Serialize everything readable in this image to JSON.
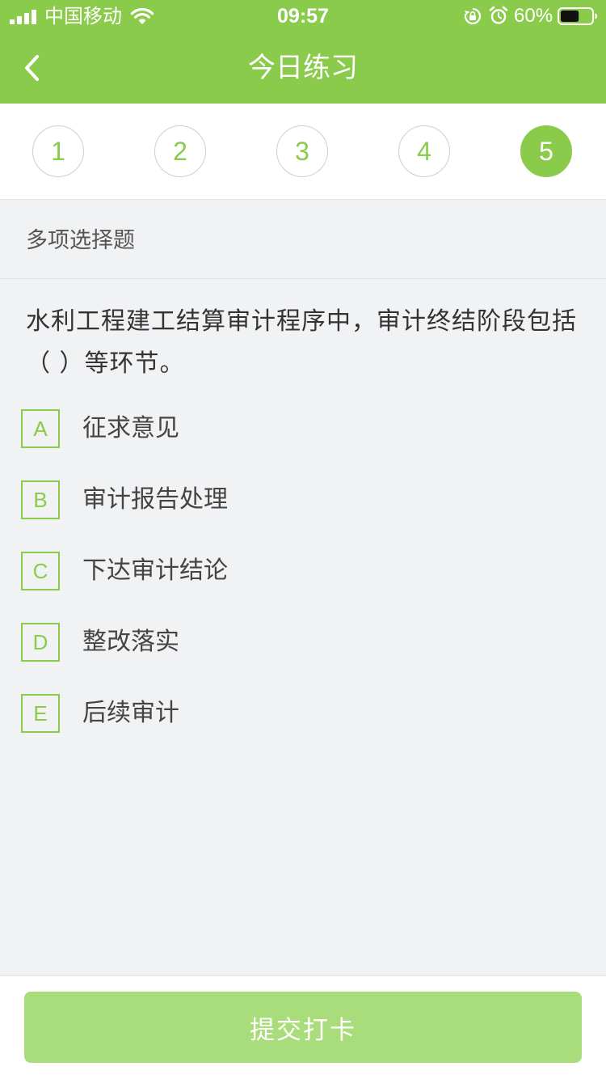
{
  "status_bar": {
    "carrier": "中国移动",
    "time": "09:57",
    "battery_percent": "60%",
    "battery_level": 0.6,
    "icons": [
      "signal-icon",
      "wifi-icon",
      "orientation-lock-icon",
      "alarm-icon",
      "battery-icon"
    ]
  },
  "header": {
    "title": "今日练习",
    "back_icon": "chevron-left-icon"
  },
  "tabs": [
    {
      "label": "1",
      "active": false
    },
    {
      "label": "2",
      "active": false
    },
    {
      "label": "3",
      "active": false
    },
    {
      "label": "4",
      "active": false
    },
    {
      "label": "5",
      "active": true
    }
  ],
  "question": {
    "type_label": "多项选择题",
    "text": "水利工程建工结算审计程序中，审计终结阶段包括（  ）等环节。",
    "options": [
      {
        "letter": "A",
        "text": "征求意见"
      },
      {
        "letter": "B",
        "text": "审计报告处理"
      },
      {
        "letter": "C",
        "text": "下达审计结论"
      },
      {
        "letter": "D",
        "text": "整改落实"
      },
      {
        "letter": "E",
        "text": "后续审计"
      }
    ]
  },
  "footer": {
    "submit_label": "提交打卡"
  },
  "colors": {
    "brand_green": "#8bcb4c",
    "submit_disabled_green": "#a9dc7a",
    "background": "#f1f2f4"
  }
}
